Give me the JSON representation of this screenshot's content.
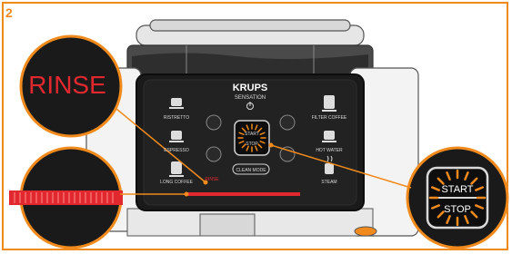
{
  "step": "2",
  "brand": "KRUPS",
  "model": "SENSATION",
  "left_buttons": [
    "RISTRETTO",
    "ESPRESSO",
    "LONG COFFEE"
  ],
  "right_buttons": [
    "FILTER COFFEE",
    "HOT WATER",
    "STEAM"
  ],
  "center_button": {
    "top": "START",
    "bottom": "STOP"
  },
  "clean_mode": "CLEAN MODE",
  "rinse_status": "RINSE",
  "zoom_rinse_label": "RINSE",
  "zoom_start": "START",
  "zoom_stop": "STOP",
  "colors": {
    "accent": "#f08a1c",
    "rinse_red": "#e0282e",
    "panel": "#1a1a1a"
  },
  "icons": [
    "power-icon",
    "ristretto-cup-icon",
    "espresso-cup-icon",
    "long-coffee-cup-icon",
    "filter-coffee-icon",
    "hot-water-icon",
    "steam-icon"
  ]
}
